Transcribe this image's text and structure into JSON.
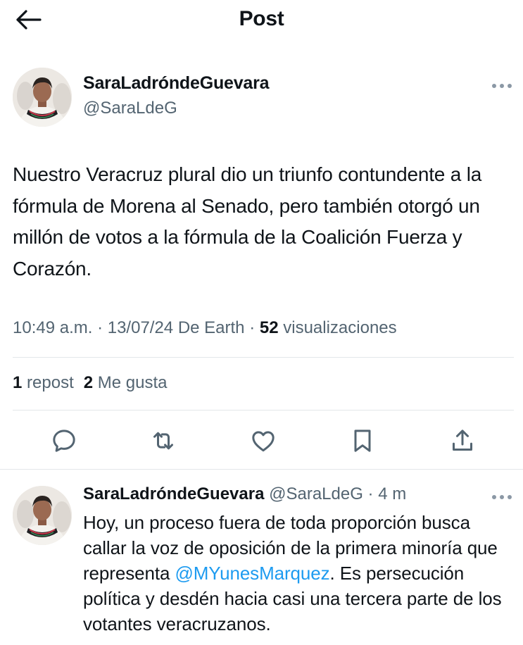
{
  "header": {
    "title": "Post",
    "back_icon": "arrow-left-icon"
  },
  "post": {
    "author_name": "SaraLadróndeGuevara",
    "author_handle": "@SaraLdeG",
    "text": "Nuestro Veracruz plural dio un triunfo contundente a la fórmula de Morena al Senado, pero también otorgó un millón de votos a la fórmula de la Coalición Fuerza y Corazón.",
    "time": "10:49 a.m. · 13/07/24 De Earth · ",
    "views_count": "52",
    "views_label": " visualizaciones",
    "reposts_count": "1",
    "reposts_label": " repost",
    "likes_count": "2",
    "likes_label": " Me gusta"
  },
  "actions": [
    {
      "name": "reply",
      "icon": "reply-icon"
    },
    {
      "name": "repost",
      "icon": "repost-icon"
    },
    {
      "name": "like",
      "icon": "heart-icon"
    },
    {
      "name": "bookmark",
      "icon": "bookmark-icon"
    },
    {
      "name": "share",
      "icon": "share-icon"
    }
  ],
  "reply": {
    "author_name": "SaraLadróndeGuevara",
    "meta": " @SaraLdeG · 4 m",
    "text_before": "Hoy, un proceso fuera de toda proporción busca callar la voz de oposición de la primera minoría que representa ",
    "mention": "@MYunesMarquez",
    "text_after": ". Es persecución política y desdén hacia casi una tercera parte de los votantes veracruzanos."
  },
  "colors": {
    "text": "#0f1419",
    "secondary": "#536471",
    "accent": "#1d9bf0",
    "divider": "#e3e7ea"
  }
}
